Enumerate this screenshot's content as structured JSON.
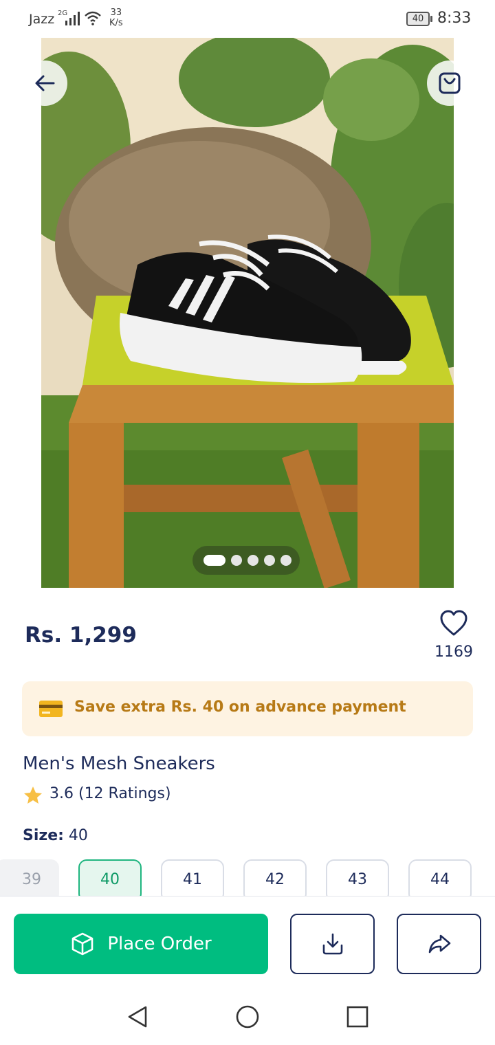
{
  "status_bar": {
    "carrier": "Jazz",
    "network_type": "2G",
    "speed_value": "33",
    "speed_unit": "K/s",
    "battery": "40",
    "time": "8:33"
  },
  "gallery": {
    "image_count": 5,
    "active_index": 0
  },
  "product": {
    "price": "Rs. 1,299",
    "wishlist_count": "1169",
    "title": "Men's Mesh Sneakers",
    "rating": "3.6 (12 Ratings)"
  },
  "offer": {
    "text": "Save extra Rs. 40 on advance payment"
  },
  "size": {
    "label": "Size:",
    "selected": "40",
    "options": [
      "39",
      "40",
      "41",
      "42",
      "43",
      "44"
    ]
  },
  "actions": {
    "place_order_label": "Place Order"
  },
  "colors": {
    "primary_green": "#00bd80",
    "navy_text": "#1d2b5a",
    "offer_bg": "#fef3e2",
    "offer_text": "#b77a16"
  },
  "icons": [
    "back-arrow-icon",
    "shopping-bag-icon",
    "heart-icon",
    "credit-card-icon",
    "star-icon",
    "box-icon",
    "download-icon",
    "share-icon"
  ]
}
